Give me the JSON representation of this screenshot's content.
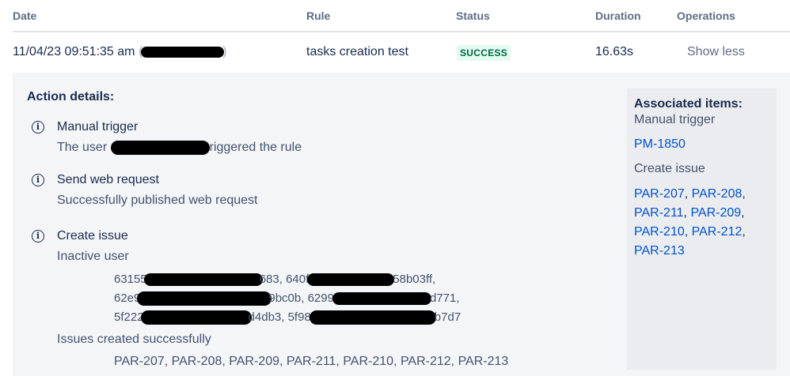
{
  "table": {
    "headers": [
      "Date",
      "Rule",
      "Status",
      "Duration",
      "Operations"
    ],
    "row": {
      "date": "11/04/23 09:51:35 am",
      "date_paren_open": "(",
      "date_paren_close": ")",
      "rule": "tasks creation test",
      "status": "SUCCESS",
      "duration": "16.63s",
      "operation": "Show less"
    }
  },
  "details": {
    "title": "Action details:",
    "actions": [
      {
        "title": "Manual trigger",
        "desc_prefix": "The user",
        "desc_suffix": "riggered the rule"
      },
      {
        "title": "Send web request",
        "desc": "Successfully published web request"
      },
      {
        "title": "Create issue",
        "inactive_label": "Inactive user",
        "inactive_lines": [
          {
            "a": "63155",
            "b": "683, 640f",
            "c": "58b03ff,"
          },
          {
            "a": "62e9",
            "b": "9bc0b, 6299",
            "c": "d771,"
          },
          {
            "a": "5f222",
            "b": "d4db3, 5f98",
            "c": "b7d7"
          }
        ],
        "created_label": "Issues created successfully",
        "created_list": "PAR-207, PAR-208, PAR-209, PAR-211, PAR-210, PAR-212, PAR-213"
      }
    ]
  },
  "associated": {
    "title": "Associated items:",
    "manual_trigger_label": "Manual trigger",
    "manual_trigger_item": "PM-1850",
    "create_issue_label": "Create issue",
    "create_issue_items": [
      "PAR-207",
      "PAR-208",
      "PAR-211",
      "PAR-209",
      "PAR-210",
      "PAR-212",
      "PAR-213"
    ]
  },
  "colors": {
    "success_bg": "#e3fcef",
    "success_text": "#006644",
    "link": "#0052cc",
    "panel_bg": "#f4f5f7"
  },
  "icons": {
    "action_icon": "info-circle-icon"
  }
}
